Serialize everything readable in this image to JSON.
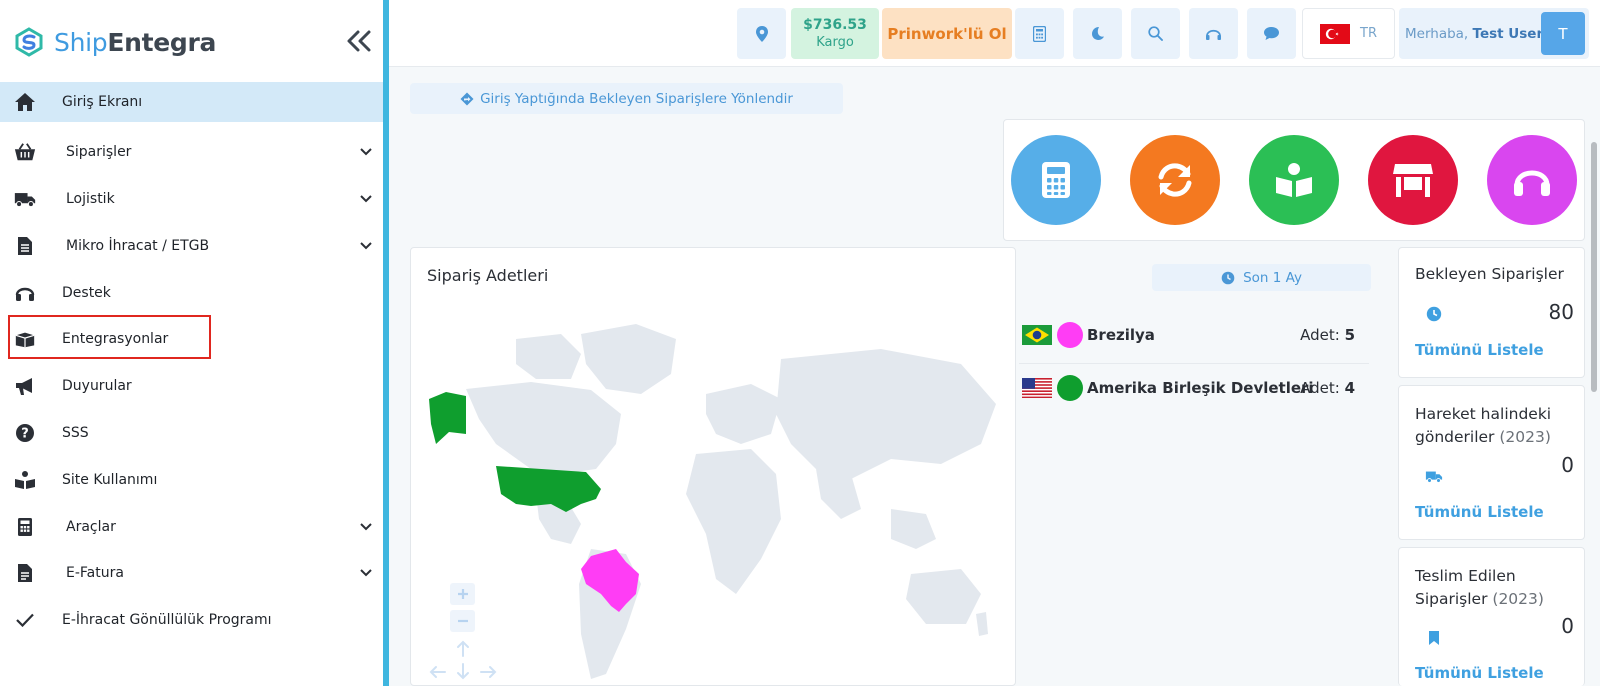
{
  "brand": {
    "name_part1": "Ship",
    "name_part2": "Entegra"
  },
  "sidebar": {
    "items": [
      {
        "label": "Giriş Ekranı",
        "icon": "home-icon",
        "active": true,
        "expandable": false
      },
      {
        "label": "Siparişler",
        "icon": "basket-icon",
        "active": false,
        "expandable": true
      },
      {
        "label": "Lojistik",
        "icon": "truck-icon",
        "active": false,
        "expandable": true
      },
      {
        "label": "Mikro İhracat / ETGB",
        "icon": "document-icon",
        "active": false,
        "expandable": true
      },
      {
        "label": "Destek",
        "icon": "headset-icon",
        "active": false,
        "expandable": false
      },
      {
        "label": "Entegrasyonlar",
        "icon": "box-icon",
        "active": false,
        "expandable": false,
        "highlighted": true
      },
      {
        "label": "Duyurular",
        "icon": "megaphone-icon",
        "active": false,
        "expandable": false
      },
      {
        "label": "SSS",
        "icon": "question-icon",
        "active": false,
        "expandable": false
      },
      {
        "label": "Site Kullanımı",
        "icon": "reader-icon",
        "active": false,
        "expandable": false
      },
      {
        "label": "Araçlar",
        "icon": "calculator-icon",
        "active": false,
        "expandable": true
      },
      {
        "label": "E-Fatura",
        "icon": "invoice-icon",
        "active": false,
        "expandable": true
      },
      {
        "label": "E-İhracat Gönüllülük Programı",
        "icon": "check-icon",
        "active": false,
        "expandable": false
      }
    ]
  },
  "topbar": {
    "balance_amount": "$736.53",
    "balance_label": "Kargo",
    "prinwork_label": "Prinwork'lü Ol",
    "language_code": "TR",
    "greeting": "Merhaba,",
    "user_name": "Test User",
    "avatar_initial": "T"
  },
  "content": {
    "redirect_label": "Giriş Yaptığında Bekleyen Siparişlere Yönlendir",
    "quick_actions": [
      {
        "icon": "calculator-icon",
        "color": "#56aee8"
      },
      {
        "icon": "refresh-icon",
        "color": "#f47920"
      },
      {
        "icon": "reader-icon",
        "color": "#2bbf55"
      },
      {
        "icon": "store-icon",
        "color": "#e0163f"
      },
      {
        "icon": "headset-icon",
        "color": "#d946ef"
      }
    ],
    "orders": {
      "title": "Sipariş Adetleri",
      "period_label": "Son 1 Ay",
      "qty_label": "Adet:",
      "countries": [
        {
          "name": "Brezilya",
          "count": "5",
          "color": "#ff3df5",
          "flag": "brazil-flag"
        },
        {
          "name": "Amerika Birleşik Devletleri",
          "count": "4",
          "color": "#0f9e2e",
          "flag": "usa-flag"
        }
      ]
    },
    "stats": [
      {
        "title": "Bekleyen Siparişler",
        "year": "",
        "value": "80",
        "link": "Tümünü Listele",
        "icon": "clock-icon"
      },
      {
        "title": "Hareket halindeki gönderiler",
        "year": "(2023)",
        "value": "0",
        "link": "Tümünü Listele",
        "icon": "truck-icon"
      },
      {
        "title": "Teslim Edilen Siparişler",
        "year": "(2023)",
        "value": "0",
        "link": "Tümünü Listele",
        "icon": "bookmark-icon"
      }
    ]
  },
  "colors": {
    "accent": "#3fb6df",
    "sidebar_active_bg": "#d3e9f8",
    "highlight_red": "#e0271f",
    "link_blue": "#3fa0e0"
  }
}
